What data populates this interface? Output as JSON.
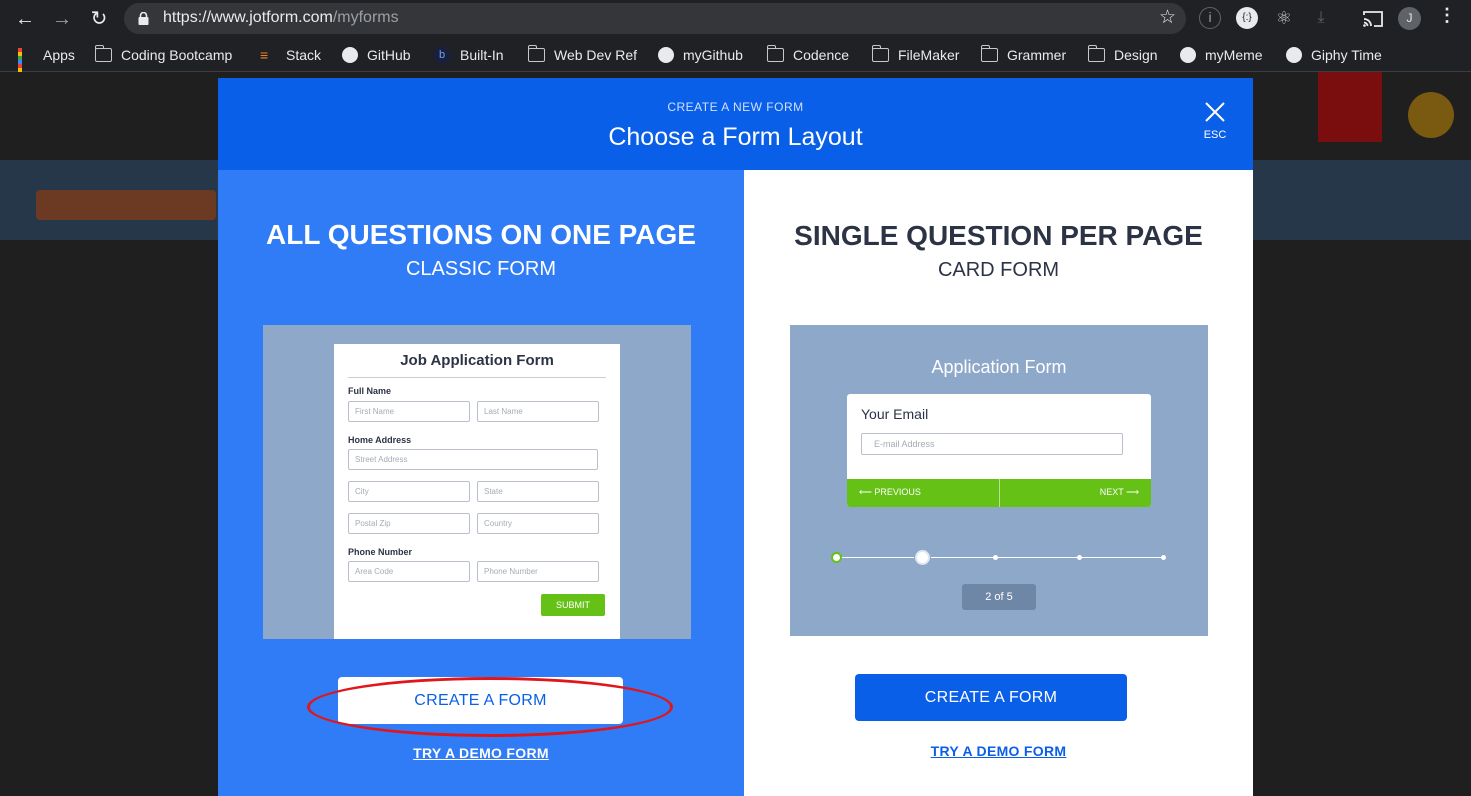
{
  "browser": {
    "url_host": "https://www.jotform.com",
    "url_path": "/myforms",
    "profile_initial": "J",
    "nav": {
      "back": "←",
      "forward": "→",
      "reload": "↻"
    },
    "bookmarks": [
      {
        "label": "Apps",
        "icon": "apps-grid-icon"
      },
      {
        "label": "Coding Bootcamp",
        "icon": "folder-icon"
      },
      {
        "label": "Stack",
        "icon": "stackoverflow-icon"
      },
      {
        "label": "GitHub",
        "icon": "github-icon"
      },
      {
        "label": "Built-In",
        "icon": "builtin-icon"
      },
      {
        "label": "Web Dev Ref",
        "icon": "folder-icon"
      },
      {
        "label": "myGithub",
        "icon": "globe-icon"
      },
      {
        "label": "Codence",
        "icon": "folder-icon"
      },
      {
        "label": "FileMaker",
        "icon": "folder-icon"
      },
      {
        "label": "Grammer",
        "icon": "folder-icon"
      },
      {
        "label": "Design",
        "icon": "folder-icon"
      },
      {
        "label": "myMeme",
        "icon": "globe-icon"
      },
      {
        "label": "Giphy Time",
        "icon": "globe-icon"
      }
    ]
  },
  "modal": {
    "subtitle": "CREATE A NEW FORM",
    "title": "Choose a Form Layout",
    "close_label": "ESC",
    "colors": {
      "header": "#0a5fe8",
      "left_panel": "#2f7cf6",
      "green": "#66c117",
      "highlight": "#e2151b"
    },
    "classic": {
      "heading": "ALL QUESTIONS ON ONE PAGE",
      "subheading": "CLASSIC FORM",
      "preview": {
        "title": "Job Application Form",
        "full_name_label": "Full Name",
        "first_name": "First Name",
        "last_name": "Last Name",
        "home_address_label": "Home Address",
        "street": "Street Address",
        "city": "City",
        "state": "State",
        "postal": "Postal Zip",
        "country": "Country",
        "phone_label": "Phone Number",
        "area_code": "Area Code",
        "phone": "Phone Number",
        "submit": "SUBMIT"
      },
      "create_button": "CREATE A FORM",
      "demo_link": "TRY A DEMO FORM"
    },
    "card": {
      "heading": "SINGLE QUESTION PER PAGE",
      "subheading": "CARD FORM",
      "preview": {
        "title": "Application Form",
        "question": "Your Email",
        "placeholder": "E-mail Address",
        "previous": "PREVIOUS",
        "next": "NEXT",
        "page_indicator": "2 of 5",
        "current_step": 2,
        "total_steps": 5
      },
      "create_button": "CREATE A FORM",
      "demo_link": "TRY A DEMO FORM"
    }
  }
}
